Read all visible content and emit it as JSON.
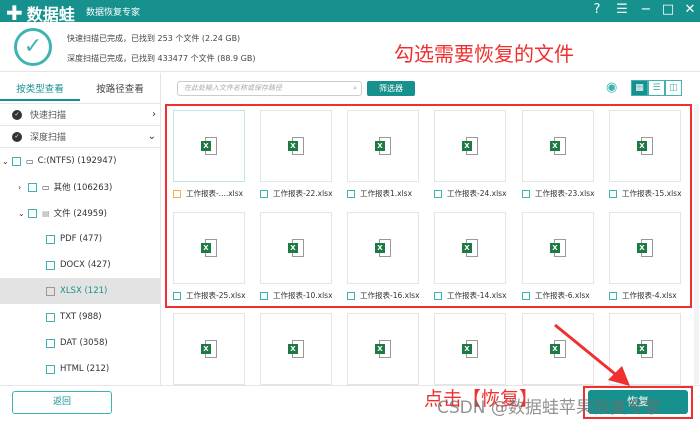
{
  "app": {
    "name": "数据蛙",
    "subtitle": "数据恢复专家"
  },
  "window_controls": {
    "help": "?",
    "menu": "☰",
    "minimize": "−",
    "maximize": "□",
    "close": "✕"
  },
  "scan": {
    "quick": "快速扫描已完成，已找到 253 个文件 (2.24 GB)",
    "deep": "深度扫描已完成，已找到 433477 个文件 (88.9 GB)"
  },
  "annotations": {
    "top": "勾选需要恢复的文件",
    "bottom": "点击【恢复】",
    "watermark": "CSDN @数据蛙苹果恢复专家"
  },
  "tabs": [
    "按类型查看",
    "按路径查看"
  ],
  "scan_rows": [
    {
      "label": "快速扫描",
      "chev": "›"
    },
    {
      "label": "深度扫描",
      "chev": "⌄"
    }
  ],
  "tree": [
    {
      "label": "C:(NTFS) (192947)",
      "arrow": "⌄",
      "icon": "💻"
    },
    {
      "label": "其他 (106263)",
      "arrow": "›",
      "icon": "🗀"
    },
    {
      "label": "文件 (24959)",
      "arrow": "⌄",
      "icon": "▤"
    },
    {
      "label": "PDF (477)"
    },
    {
      "label": "DOCX (427)"
    },
    {
      "label": "XLSX (121)",
      "selected": true
    },
    {
      "label": "TXT (988)"
    },
    {
      "label": "DAT (3058)"
    },
    {
      "label": "HTML (212)"
    }
  ],
  "search": {
    "placeholder": "在此处输入文件名称或保存路径"
  },
  "filter_label": "筛选器",
  "files": [
    "工作报表-....xlsx",
    "工作报表-22.xlsx",
    "工作报表1.xlsx",
    "工作报表-24.xlsx",
    "工作报表-23.xlsx",
    "工作报表-15.xlsx",
    "工作报表-25.xlsx",
    "工作报表-10.xlsx",
    "工作报表-16.xlsx",
    "工作报表-14.xlsx",
    "工作报表-6.xlsx",
    "工作报表-4.xlsx"
  ],
  "back_label": "返回",
  "recover_label": "恢复",
  "colors": {
    "accent": "#17918e",
    "annotation": "#f0302f"
  }
}
